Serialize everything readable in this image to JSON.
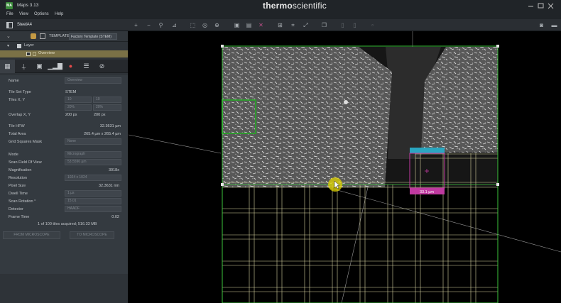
{
  "app": {
    "title": "Maps 3.13",
    "logo_text": "MA"
  },
  "brand": {
    "part1": "thermo",
    "part2": "scientific"
  },
  "menu": [
    "File",
    "View",
    "Options",
    "Help"
  ],
  "toolbar": {
    "document_name": "SteelA4"
  },
  "template": {
    "label": "TEMPLATE",
    "selected": "Factory Template (STEM)"
  },
  "tree": {
    "layer_label": "Layer",
    "overview_label": "Overview"
  },
  "properties": {
    "name_label": "Name",
    "name_value": "Overview",
    "tile_set_type_label": "Tile Set Type",
    "tile_set_type_value": "STEM",
    "tiles_xy_label": "Tiles X, Y",
    "tiles_x": "10",
    "tiles_y": "10",
    "overlap_pct_x": "20%",
    "overlap_pct_y": "20%",
    "overlap_label": "Overlap X, Y",
    "overlap_x": "200 px",
    "overlap_y": "200 px",
    "tile_hfw_label": "Tile HFW",
    "tile_hfw_value": "32.3631 µm",
    "total_area_label": "Total Area",
    "total_area_value": "265.4 µm x 265.4 µm",
    "grid_mask_label": "Grid Squares Mask",
    "grid_mask_value": "None",
    "mode_label": "Mode",
    "mode_value": "Micrograph",
    "scan_fov_label": "Scan Field Of View",
    "scan_fov_value": "53.5596 µm",
    "magnification_label": "Magnification",
    "magnification_value": "3018x",
    "resolution_label": "Resolution",
    "resolution_value": "1024 x 1024",
    "pixel_size_label": "Pixel Size",
    "pixel_size_value": "32.3631 nm",
    "dwell_time_label": "Dwell Time",
    "dwell_time_value": "1 µs",
    "scan_rotation_label": "Scan Rotation °",
    "scan_rotation_value": "15.01",
    "detector_label": "Detector",
    "detector_value": "HAADF",
    "frame_time_label": "Frame Time",
    "frame_time_value": "0.02",
    "acquired_status": "1 of 100 tiles acquired; 516.33 MB",
    "from_microscope": "FROM MICROSCOPE",
    "to_microscope": "TO MICROSCOPE"
  },
  "canvas": {
    "scale_label": "33.1 µm"
  },
  "colors": {
    "tile_outline": "#3cc43c",
    "grid_line": "#d8d3a0",
    "cursor": "#e0d400",
    "field_marker": "#c03aa0",
    "field_marker_top": "#2aa6c0"
  }
}
